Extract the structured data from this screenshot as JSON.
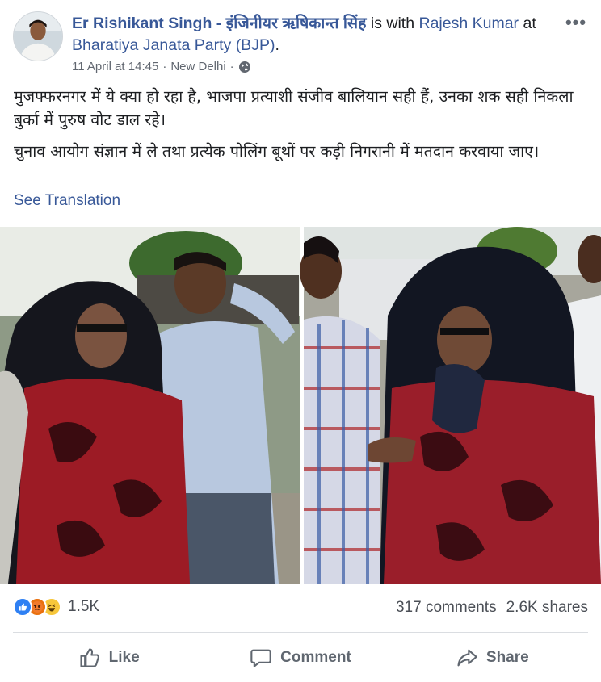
{
  "author": {
    "name": "Er Rishikant Singh - इंजिनीयर ऋषिकान्त सिंह",
    "with_text": "is with",
    "tagged": "Rajesh Kumar",
    "at_text": "at",
    "place": "Bharatiya Janata Party (BJP)",
    "period": "."
  },
  "meta": {
    "date": "11 April at 14:45",
    "separator": "·",
    "location": "New Delhi",
    "separator2": "·",
    "privacy_icon": "globe-icon"
  },
  "more_icon": "more-options-icon",
  "post": {
    "paragraph_1": "मुजफ्फरनगर में ये क्या हो रहा है, भाजपा प्रत्याशी संजीव बालियान सही हैं, उनका शक सही निकला बुर्का में पुरुष वोट डाल रहे।",
    "paragraph_2": "चुनाव आयोग संज्ञान में ले तथा प्रत्येक पोलिंग बूथों पर कड़ी निगरानी में मतदान करवाया जाए।",
    "see_translation": "See Translation"
  },
  "stats": {
    "reactions": [
      "like-icon",
      "angry-icon",
      "haha-icon"
    ],
    "reaction_count": "1.5K",
    "comments": "317 comments",
    "shares": "2.6K shares"
  },
  "actions": {
    "like": "Like",
    "comment": "Comment",
    "share": "Share"
  },
  "colors": {
    "link": "#385898",
    "text": "#1c1e21",
    "muted": "#616770",
    "like_blue": "#2f80f3"
  }
}
